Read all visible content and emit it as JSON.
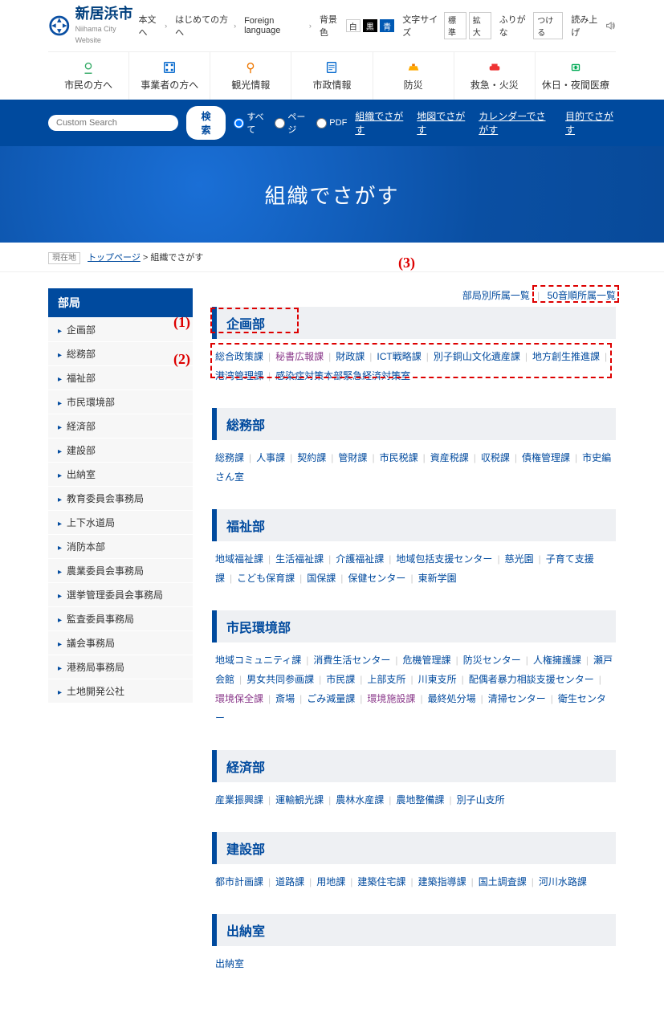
{
  "site": {
    "name_jp": "新居浜市",
    "name_en": "Niihama City Website"
  },
  "header_links": {
    "skip": "本文へ",
    "first": "はじめての方へ",
    "lang": "Foreign language",
    "bg_label": "背景色",
    "bg_white": "白",
    "bg_black": "黒",
    "bg_blue": "青",
    "fs_label": "文字サイズ",
    "fs_std": "標準",
    "fs_big": "拡大",
    "furigana_label": "ふりがな",
    "furigana_on": "つける",
    "read": "読み上げ"
  },
  "nav": [
    {
      "label": "市民の方へ"
    },
    {
      "label": "事業者の方へ"
    },
    {
      "label": "観光情報"
    },
    {
      "label": "市政情報"
    },
    {
      "label": "防災"
    },
    {
      "label": "救急・火災"
    },
    {
      "label": "休日・夜間医療"
    }
  ],
  "search": {
    "placeholder": "Custom Search",
    "engine": "Google",
    "button": "検索",
    "opt_all": "すべて",
    "opt_page": "ページ",
    "opt_pdf": "PDF",
    "links": [
      "組織でさがす",
      "地図でさがす",
      "カレンダーでさがす",
      "目的でさがす"
    ]
  },
  "hero": {
    "title": "組織でさがす"
  },
  "breadcrumb": {
    "label": "現在地",
    "home": "トップページ",
    "sep": ">",
    "current": "組織でさがす"
  },
  "sidebar": {
    "title": "部局",
    "items": [
      "企画部",
      "総務部",
      "福祉部",
      "市民環境部",
      "経済部",
      "建設部",
      "出納室",
      "教育委員会事務局",
      "上下水道局",
      "消防本部",
      "農業委員会事務局",
      "選挙管理委員会事務局",
      "監査委員事務局",
      "議会事務局",
      "港務局事務局",
      "土地開発公社"
    ]
  },
  "tabs": {
    "by_dept": "部局別所属一覧",
    "by_sound": "50音順所属一覧"
  },
  "annotations": {
    "a1": "(1)",
    "a2": "(2)",
    "a3": "(3)"
  },
  "departments": [
    {
      "name": "企画部",
      "divisions": [
        {
          "t": "総合政策課"
        },
        {
          "t": "秘書広報課",
          "visited": true
        },
        {
          "t": "財政課"
        },
        {
          "t": "ICT戦略課"
        },
        {
          "t": "別子銅山文化遺産課"
        },
        {
          "t": "地方創生推進課"
        },
        {
          "t": "港湾管理課"
        },
        {
          "t": "感染症対策本部緊急経済対策室"
        }
      ]
    },
    {
      "name": "総務部",
      "divisions": [
        {
          "t": "総務課"
        },
        {
          "t": "人事課"
        },
        {
          "t": "契約課"
        },
        {
          "t": "管財課"
        },
        {
          "t": "市民税課"
        },
        {
          "t": "資産税課"
        },
        {
          "t": "収税課"
        },
        {
          "t": "債権管理課"
        },
        {
          "t": "市史編さん室"
        }
      ]
    },
    {
      "name": "福祉部",
      "divisions": [
        {
          "t": "地域福祉課"
        },
        {
          "t": "生活福祉課"
        },
        {
          "t": "介護福祉課"
        },
        {
          "t": "地域包括支援センター"
        },
        {
          "t": "慈光園"
        },
        {
          "t": "子育て支援課"
        },
        {
          "t": "こども保育課"
        },
        {
          "t": "国保課"
        },
        {
          "t": "保健センター"
        },
        {
          "t": "東新学園"
        }
      ]
    },
    {
      "name": "市民環境部",
      "divisions": [
        {
          "t": "地域コミュニティ課"
        },
        {
          "t": "消費生活センター"
        },
        {
          "t": "危機管理課"
        },
        {
          "t": "防災センター"
        },
        {
          "t": "人権擁護課"
        },
        {
          "t": "瀬戸会館"
        },
        {
          "t": "男女共同参画課"
        },
        {
          "t": "市民課"
        },
        {
          "t": "上部支所"
        },
        {
          "t": "川東支所"
        },
        {
          "t": "配偶者暴力相談支援センター"
        },
        {
          "t": "環境保全課",
          "visited": true
        },
        {
          "t": "斎場"
        },
        {
          "t": "ごみ減量課"
        },
        {
          "t": "環境施設課",
          "visited": true
        },
        {
          "t": "最終処分場"
        },
        {
          "t": "清掃センター"
        },
        {
          "t": "衛生センター"
        }
      ]
    },
    {
      "name": "経済部",
      "divisions": [
        {
          "t": "産業振興課"
        },
        {
          "t": "運輸観光課"
        },
        {
          "t": "農林水産課"
        },
        {
          "t": "農地整備課"
        },
        {
          "t": "別子山支所"
        }
      ]
    },
    {
      "name": "建設部",
      "divisions": [
        {
          "t": "都市計画課"
        },
        {
          "t": "道路課"
        },
        {
          "t": "用地課"
        },
        {
          "t": "建築住宅課"
        },
        {
          "t": "建築指導課"
        },
        {
          "t": "国土調査課"
        },
        {
          "t": "河川水路課"
        }
      ]
    },
    {
      "name": "出納室",
      "divisions": [
        {
          "t": "出納室"
        }
      ]
    }
  ]
}
